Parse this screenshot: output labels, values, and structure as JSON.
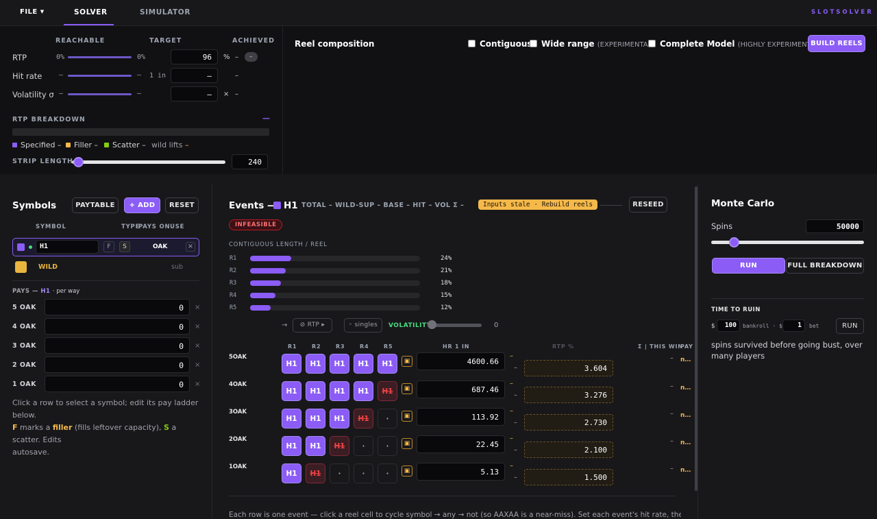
{
  "topbar": {
    "file": "FILE",
    "tabs": [
      "SOLVER",
      "SIMULATOR"
    ],
    "brand": "SLOTSOLVER"
  },
  "targets": {
    "headers": [
      "REACHABLE",
      "TARGET",
      "ACHIEVED"
    ],
    "rtp": {
      "label": "RTP",
      "reach_lo": "0%",
      "reach_hi": "0%",
      "value": "96",
      "unit": "%",
      "achieved": "–",
      "pill": "–"
    },
    "hit": {
      "label": "Hit rate",
      "reach_lo": "–",
      "reach_hi": "–",
      "prefix": "1 in",
      "value": "–",
      "achieved": "–"
    },
    "vol": {
      "label": "Volatility σ",
      "reach_lo": "–",
      "reach_hi": "–",
      "value": "–",
      "unit": "×",
      "achieved": "–"
    },
    "breakdown_label": "RTP BREAKDOWN",
    "breakdown_dash": "—",
    "legend": {
      "specified": "Specified",
      "filler": "Filler",
      "scatter": "Scatter",
      "wild": "wild lifts",
      "dash": "–"
    },
    "strip_label": "STRIP LENGTH",
    "strip_value": "240",
    "strip_fraction": 0.02
  },
  "reel": {
    "title": "Reel composition",
    "contiguous": "Contiguous",
    "wide": "Wide range",
    "wide_tag": "(EXPERIMENTAL)",
    "complete": "Complete Model",
    "complete_tag": "(HIGHLY EXPERIMENTAL)",
    "build": "BUILD REELS"
  },
  "symbols": {
    "title": "Symbols",
    "paytable": "PAYTABLE",
    "add": "+ ADD",
    "reset": "RESET",
    "cols": [
      "SYMBOL",
      "TYPE",
      "PAYS ON",
      "USE"
    ],
    "h1": {
      "name": "H1",
      "f": "F",
      "s": "S",
      "pays": "OAK",
      "remove": "×"
    },
    "wild": {
      "name": "WILD",
      "use": "sub"
    },
    "pays_title": "PAYS —",
    "pays_sym": "H1",
    "pays_per": "· per way",
    "rows": [
      {
        "label": "5 OAK",
        "value": "0"
      },
      {
        "label": "4 OAK",
        "value": "0"
      },
      {
        "label": "3 OAK",
        "value": "0"
      },
      {
        "label": "2 OAK",
        "value": "0"
      },
      {
        "label": "1 OAK",
        "value": "0"
      }
    ],
    "x": "×",
    "help_1": "Click a row to select a symbol; edit its pay ladder below.",
    "help_2a": "F",
    "help_2b": " marks a ",
    "help_2c": "filler",
    "help_2d": " (fills leftover capacity), ",
    "help_2e": "S",
    "help_2f": " a scatter. Edits",
    "help_3": "autosave."
  },
  "events": {
    "title": "Events —",
    "sym": "H1",
    "stats": "TOTAL – WILD-SUP – BASE – HIT – VOL Σ –",
    "stale": "Inputs stale · Rebuild reels",
    "reseed": "RESEED",
    "infeasible": "INFEASIBLE",
    "contig_title": "CONTIGUOUS LENGTH / REEL",
    "reels": [
      {
        "label": "R1",
        "pct": "24%",
        "frac": 0.24
      },
      {
        "label": "R2",
        "pct": "21%",
        "frac": 0.21
      },
      {
        "label": "R3",
        "pct": "18%",
        "frac": 0.18
      },
      {
        "label": "R4",
        "pct": "15%",
        "frac": 0.15
      },
      {
        "label": "R5",
        "pct": "12%",
        "frac": 0.12
      }
    ],
    "arrow": "→",
    "rtp_btn": "⊘ RTP ▸",
    "singles": "◦ singles",
    "volatility": "VOLATILITY",
    "vol_value": "0",
    "cols": [
      "R1",
      "R2",
      "R3",
      "R4",
      "R5",
      "HR 1 IN",
      "RTP %",
      "Σ | THIS WIN",
      "PAY"
    ],
    "rows": [
      {
        "label": "5OAK",
        "cells": [
          "H1",
          "H1",
          "H1",
          "H1",
          "H1"
        ],
        "hr": "4600.66",
        "rtp": "3.604"
      },
      {
        "label": "4OAK",
        "cells": [
          "H1",
          "H1",
          "H1",
          "H1",
          "H1x"
        ],
        "hr": "687.46",
        "rtp": "3.276"
      },
      {
        "label": "3OAK",
        "cells": [
          "H1",
          "H1",
          "H1",
          "H1x",
          "·"
        ],
        "hr": "113.92",
        "rtp": "2.730"
      },
      {
        "label": "2OAK",
        "cells": [
          "H1",
          "H1",
          "H1x",
          "·",
          "·"
        ],
        "hr": "22.45",
        "rtp": "2.100"
      },
      {
        "label": "1OAK",
        "cells": [
          "H1",
          "H1x",
          "·",
          "·",
          "·"
        ],
        "hr": "5.13",
        "rtp": "1.500"
      }
    ],
    "dash": "–",
    "pay_n": "n…",
    "footer": "Each row is one event — click a reel cell to cycle symbol → any → not (so AAXAA is a near-miss). Set each event's hit rate, then its"
  },
  "monte": {
    "title": "Monte Carlo",
    "spins_label": "Spins",
    "spins": "50000",
    "spins_fraction": 0.15,
    "run": "RUN",
    "breakdown": "FULL BREAKDOWN",
    "ruin_title": "TIME TO RUIN",
    "dollar": "$",
    "bankroll": "100",
    "bankroll_lbl": "bankroll · $",
    "bet": "1",
    "bet_lbl": "bet",
    "run2": "RUN",
    "desc": "spins survived before going bust, over many players"
  }
}
